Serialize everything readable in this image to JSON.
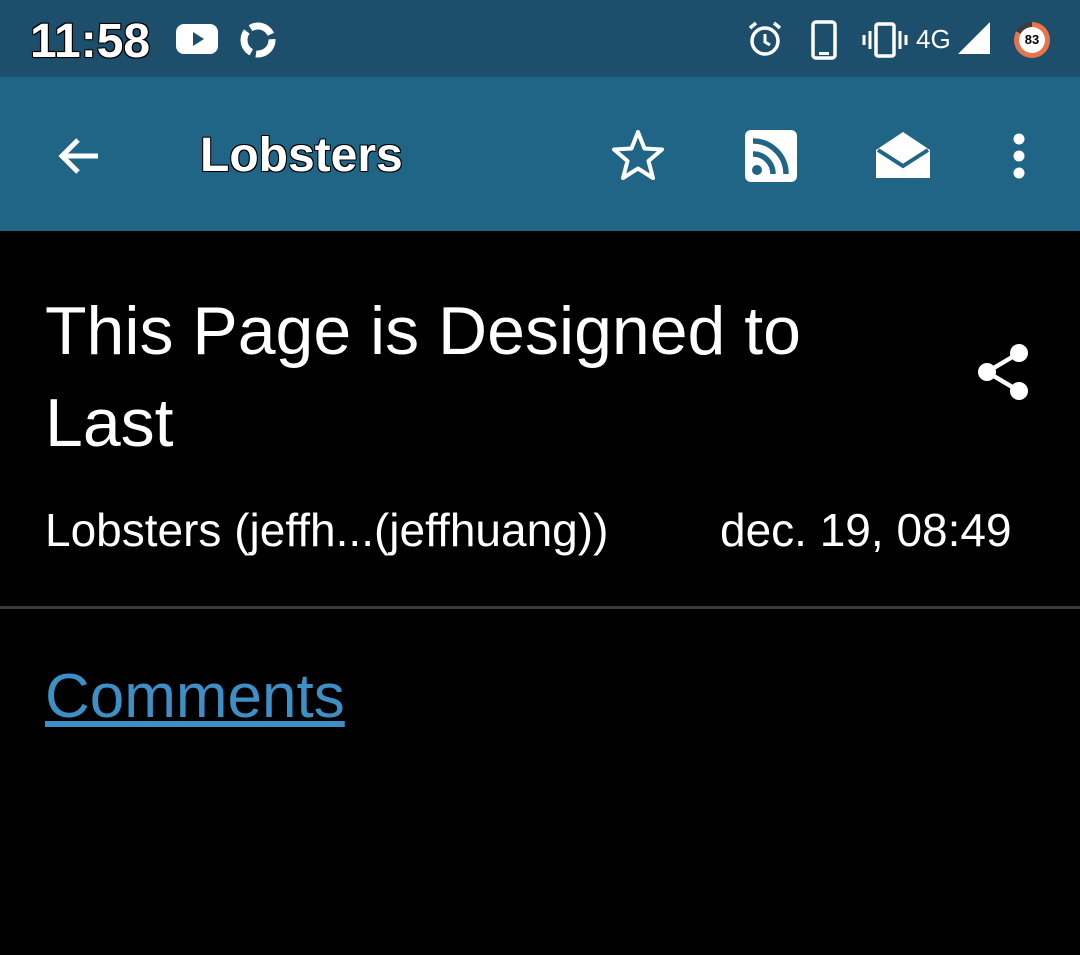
{
  "status_bar": {
    "time": "11:58",
    "network": "4G",
    "battery": "83",
    "icons": [
      "youtube-icon",
      "sync-icon",
      "alarm-icon",
      "phone-icon",
      "vibrate-icon",
      "signal-icon",
      "battery-icon"
    ]
  },
  "app_bar": {
    "title": "Lobsters",
    "icons": [
      "back-arrow-icon",
      "star-icon",
      "rss-icon",
      "mail-open-icon",
      "more-vert-icon"
    ]
  },
  "article": {
    "title": "This Page is Designed to Last",
    "author": "Lobsters (jeffh...(jeffhuang))",
    "date": "dec. 19, 08:49",
    "comments_label": "Comments"
  },
  "colors": {
    "status_bar_bg": "#1d4f6c",
    "app_bar_bg": "#216586",
    "background": "#000000",
    "link": "#3d8fc6"
  }
}
